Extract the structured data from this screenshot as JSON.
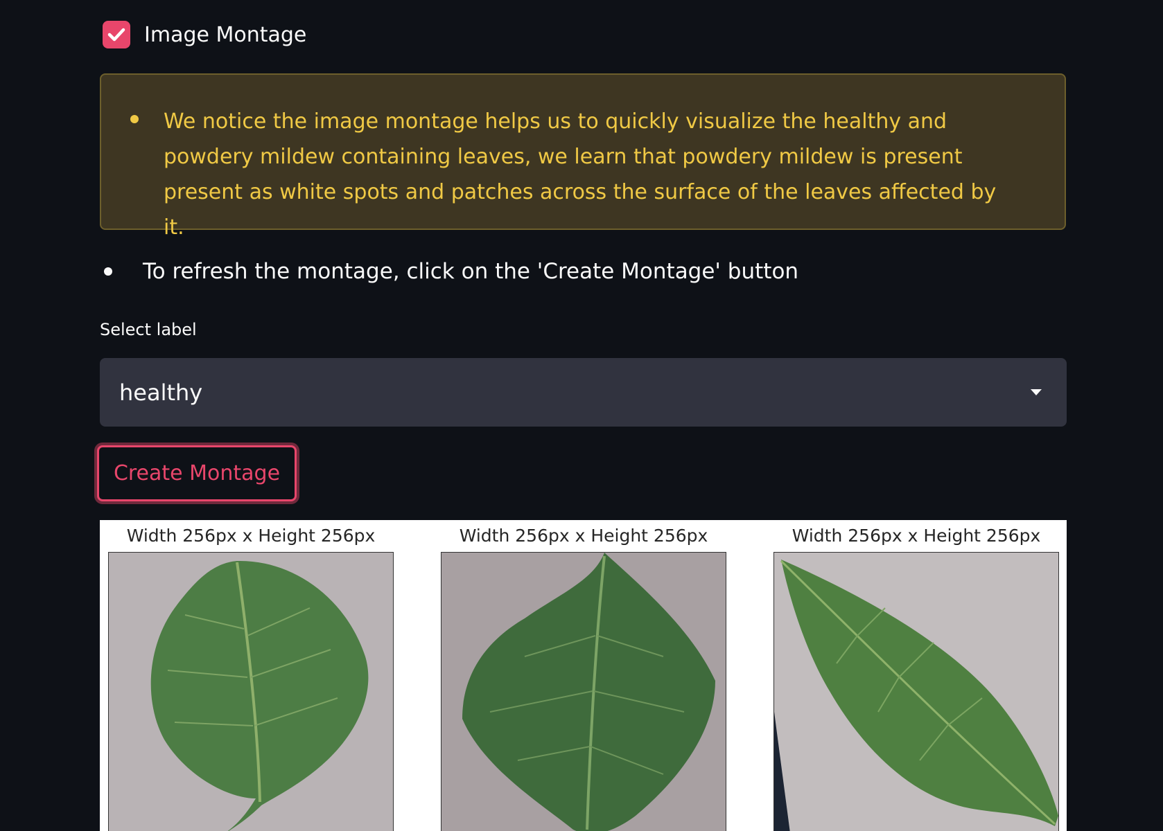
{
  "checkbox": {
    "label": "Image Montage",
    "checked": true,
    "color": "#e8466b"
  },
  "alert": {
    "text": "We notice the image montage helps us to quickly visualize the healthy and powdery mildew containing leaves, we learn that powdery mildew is present present as white spots and patches across the surface of the leaves affected by it.",
    "text_color": "#f0c945",
    "background": "#3e3622"
  },
  "info": {
    "text": "To refresh the montage, click on the 'Create Montage' button"
  },
  "select": {
    "label": "Select label",
    "value": "healthy"
  },
  "button": {
    "label": "Create Montage"
  },
  "montage": {
    "images": [
      {
        "caption": "Width 256px x Height 256px",
        "icon": "leaf-image"
      },
      {
        "caption": "Width 256px x Height 256px",
        "icon": "leaf-image"
      },
      {
        "caption": "Width 256px x Height 256px",
        "icon": "leaf-image"
      }
    ]
  }
}
